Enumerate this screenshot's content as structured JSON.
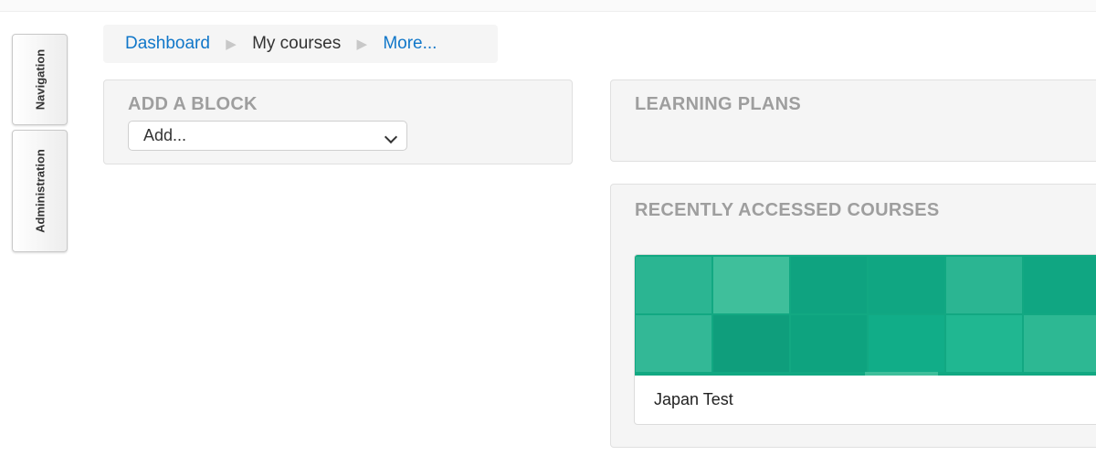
{
  "side_tabs": {
    "navigation": "Navigation",
    "administration": "Administration"
  },
  "breadcrumb": {
    "items": [
      "Dashboard",
      "My courses",
      "More..."
    ],
    "separator": "▶"
  },
  "add_block": {
    "title": "ADD A BLOCK",
    "select_value": "Add..."
  },
  "learning_plans": {
    "title": "LEARNING PLANS"
  },
  "recently_accessed": {
    "title": "RECENTLY ACCESSED COURSES",
    "courses": [
      {
        "name": "Japan Test",
        "image_color": "#12a882"
      }
    ]
  },
  "colors": {
    "link": "#1177c9",
    "block_bg": "#f5f5f5",
    "block_title": "#9e9e9e",
    "course_pattern_base": "#12a882"
  },
  "icons": {
    "breadcrumb_separator": "triangle-right-icon",
    "select_chevron": "chevron-down-icon"
  }
}
